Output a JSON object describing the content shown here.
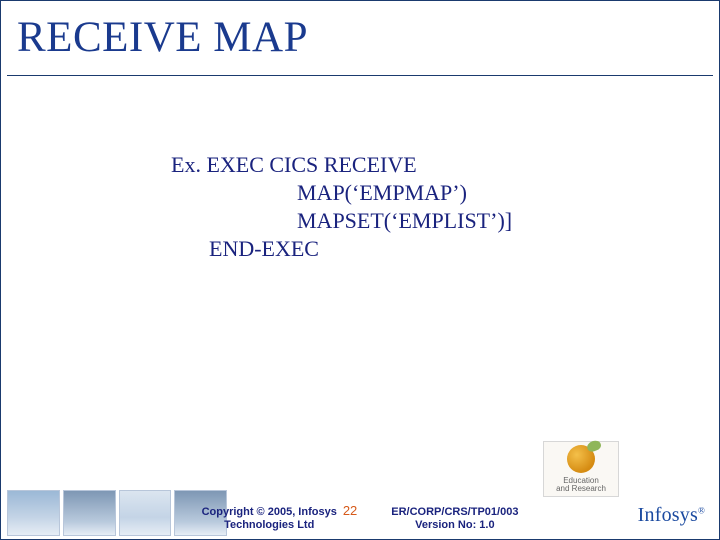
{
  "title": "RECEIVE MAP",
  "code": {
    "line1": "Ex. EXEC CICS RECEIVE",
    "line2": "MAP(‘EMPMAP’)",
    "line3": "MAPSET(‘EMPLIST’)]",
    "line4": "END-EXEC"
  },
  "footer": {
    "copyright_line1": "Copyright © 2005, Infosys",
    "copyright_line2": "Technologies Ltd",
    "page_number": "22",
    "docref_line1": "ER/CORP/CRS/TP01/003",
    "docref_line2": "Version No: 1.0"
  },
  "badge": {
    "line1": "Education",
    "line2": "and Research"
  },
  "logo": {
    "text": "Infosys",
    "reg": "®"
  }
}
